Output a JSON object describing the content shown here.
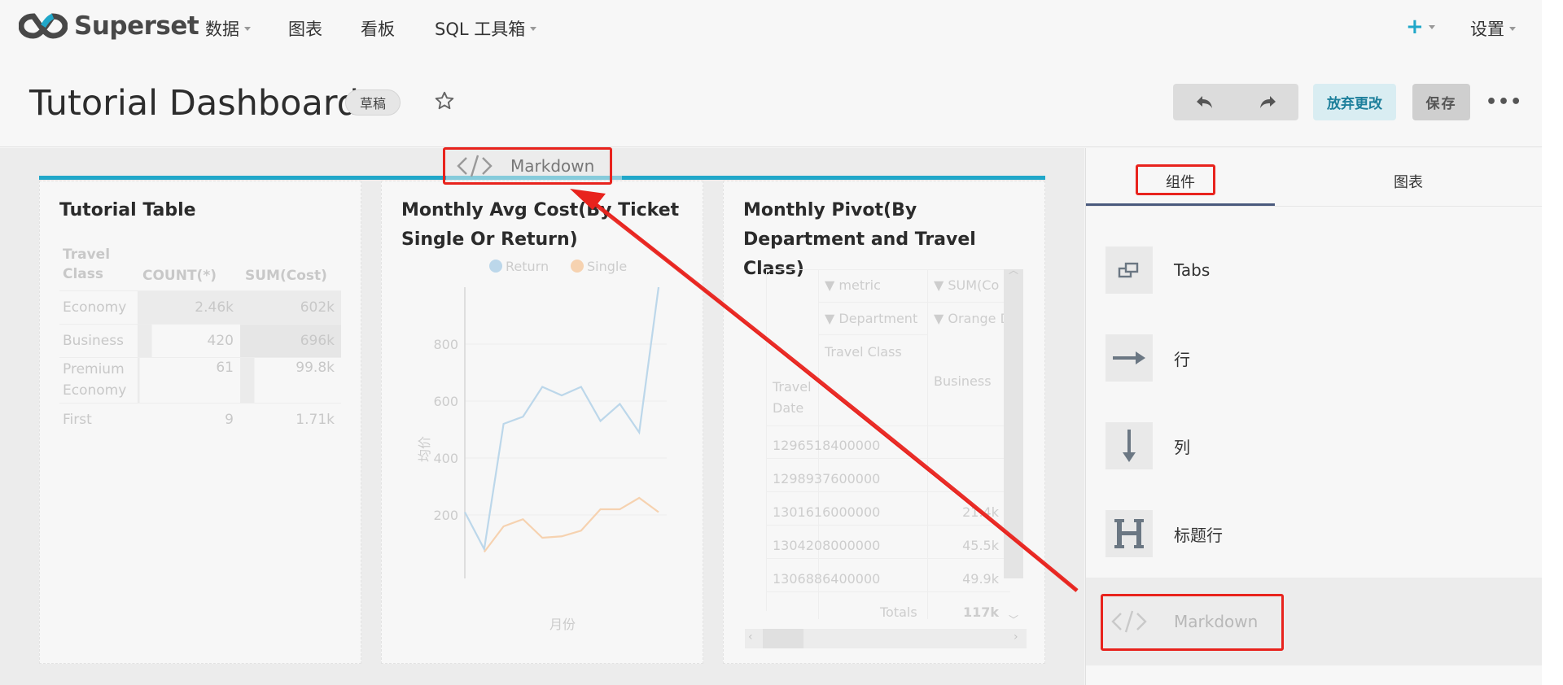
{
  "brand": {
    "name": "Superset"
  },
  "nav": {
    "items": [
      {
        "label": "数据",
        "has_caret": true
      },
      {
        "label": "图表",
        "has_caret": false
      },
      {
        "label": "看板",
        "has_caret": false
      },
      {
        "label": "SQL 工具箱",
        "has_caret": true
      }
    ],
    "plus_label": "+",
    "settings_label": "设置"
  },
  "dashboard": {
    "title": "Tutorial Dashboard",
    "status_badge": "草稿",
    "discard_label": "放弃更改",
    "save_label": "保存",
    "more_label": "•••"
  },
  "drag_ghost": {
    "label": "Markdown",
    "icon": "code-icon"
  },
  "charts": {
    "table": {
      "title": "Tutorial Table",
      "columns": [
        "Travel Class",
        "COUNT(*)",
        "SUM(Cost)"
      ],
      "rows": [
        [
          "Economy",
          "2.46k",
          "602k"
        ],
        [
          "Business",
          "420",
          "696k"
        ],
        [
          "Premium Economy",
          "61",
          "99.8k"
        ],
        [
          "First",
          "9",
          "1.71k"
        ]
      ]
    },
    "line": {
      "title": "Monthly Avg Cost(By Ticket Single Or Return)",
      "xlabel": "月份",
      "ylabel": "均价",
      "legend": [
        "Return",
        "Single"
      ]
    },
    "pivot": {
      "title": "Monthly Pivot(By Department and Travel Class)",
      "header_metric": "▼ metric",
      "header_sum": "▼ SUM(Co",
      "header_department": "▼ Department",
      "header_orange": "▼ Orange D",
      "header_travel_class": "Travel Class",
      "header_travel_date": "Travel Date",
      "header_business": "Business",
      "rows": [
        [
          "1296518400000",
          ""
        ],
        [
          "1298937600000",
          ""
        ],
        [
          "1301616000000",
          "21.4k"
        ],
        [
          "1304208000000",
          "45.5k"
        ],
        [
          "1306886400000",
          "49.9k"
        ]
      ],
      "totals_label": "Totals",
      "totals_value": "117k"
    }
  },
  "chart_data": {
    "type": "line",
    "title": "Monthly Avg Cost(By Ticket Single Or Return)",
    "xlabel": "月份",
    "ylabel": "均价",
    "ylim": [
      0,
      1000
    ],
    "yticks": [
      200,
      400,
      600,
      800
    ],
    "x": [
      1,
      2,
      3,
      4,
      5,
      6,
      7,
      8,
      9,
      10,
      11,
      12
    ],
    "series": [
      {
        "name": "Return",
        "values": [
          210,
          80,
          520,
          545,
          650,
          620,
          650,
          530,
          590,
          490,
          1000,
          null
        ]
      },
      {
        "name": "Single",
        "values": [
          null,
          70,
          160,
          185,
          120,
          125,
          145,
          220,
          220,
          260,
          210,
          null
        ]
      }
    ],
    "grid": true,
    "legend": "top-center"
  },
  "panel": {
    "tabs": [
      "组件",
      "图表"
    ],
    "components": [
      {
        "label": "Tabs",
        "icon": "tabs-icon"
      },
      {
        "label": "行",
        "icon": "arrow-right-icon"
      },
      {
        "label": "列",
        "icon": "arrow-down-icon"
      },
      {
        "label": "标题行",
        "icon": "heading-icon"
      },
      {
        "label": "Markdown",
        "icon": "code-icon"
      }
    ]
  },
  "colors": {
    "accent": "#20a7c9",
    "highlight": "#e8231d",
    "return_series": "#bcd7ea",
    "single_series": "#f6d2b0"
  }
}
